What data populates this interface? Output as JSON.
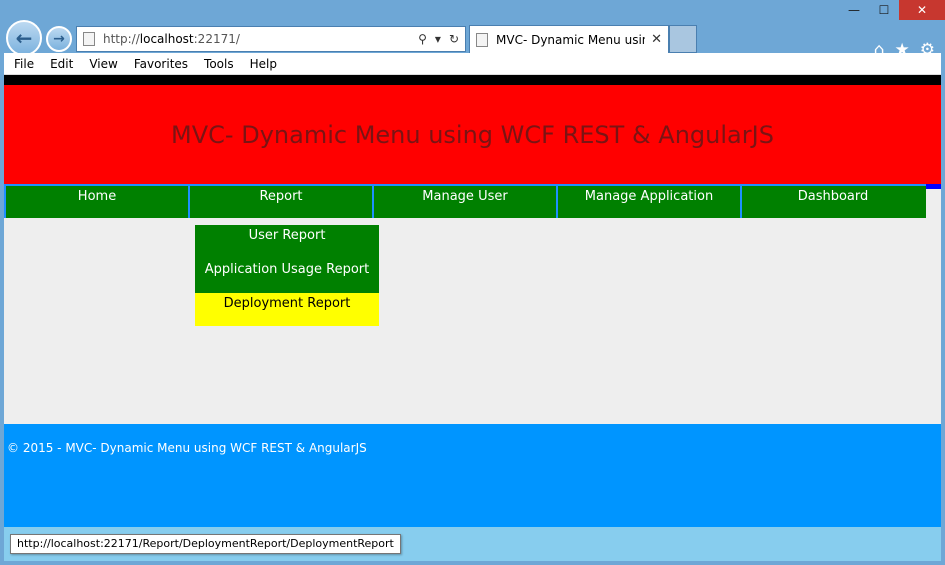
{
  "window": {
    "minimize": "—",
    "maximize": "☐",
    "close": "✕"
  },
  "browser": {
    "address_scheme": "http://",
    "address_host": "localhost",
    "address_rest": ":22171/",
    "tab_title": "MVC- Dynamic Menu usin...",
    "tab_close": "✕"
  },
  "menubar": {
    "items": [
      {
        "label": "File"
      },
      {
        "label": "Edit"
      },
      {
        "label": "View"
      },
      {
        "label": "Favorites"
      },
      {
        "label": "Tools"
      },
      {
        "label": "Help"
      }
    ]
  },
  "page": {
    "header_title": "MVC- Dynamic Menu using WCF REST & AngularJS",
    "nav": [
      {
        "label": "Home"
      },
      {
        "label": "Report"
      },
      {
        "label": "Manage User"
      },
      {
        "label": "Manage Application"
      },
      {
        "label": "Dashboard"
      }
    ],
    "dropdown": [
      {
        "label": "User Report"
      },
      {
        "label": "Application Usage Report"
      },
      {
        "label": "Deployment Report"
      }
    ],
    "footer_text": "© 2015 - MVC- Dynamic Menu using WCF REST & AngularJS"
  },
  "status": {
    "url": "http://localhost:22171/Report/DeploymentReport/DeploymentReport"
  },
  "colors": {
    "header_bg": "#ff0000",
    "nav_bg": "#008000",
    "active_dropdown_bg": "#ffff00",
    "footer_bg": "#0095ff"
  }
}
